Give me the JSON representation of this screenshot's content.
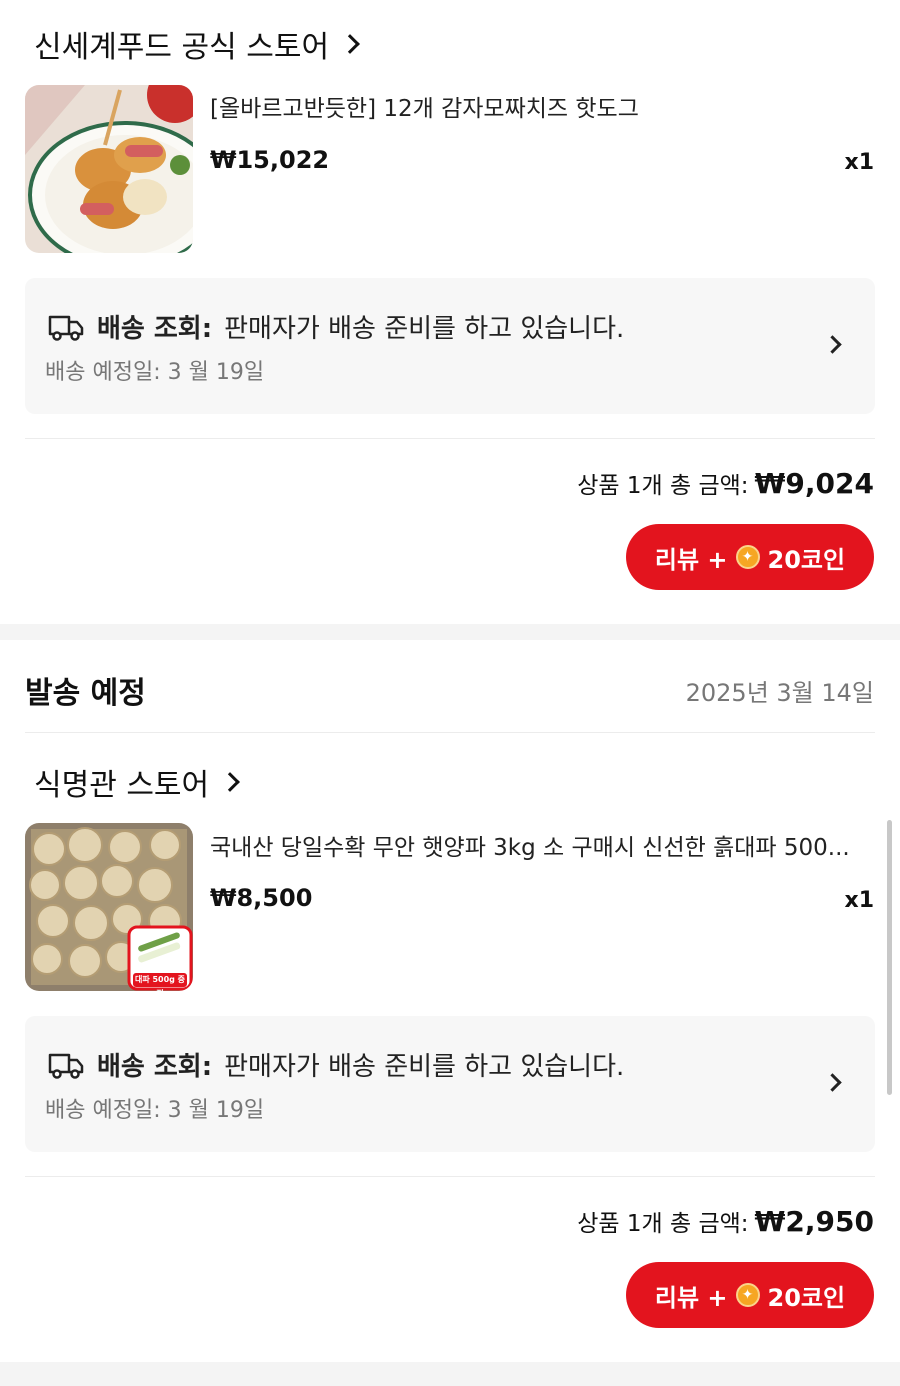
{
  "order1": {
    "store_name": "신세계푸드 공식 스토어",
    "product_title": "[올바르고반듯한] 12개 감자모짜치즈 핫도그",
    "price": "₩15,022",
    "qty": "x1",
    "shipping": {
      "label": "배송 조회:",
      "status": "판매자가 배송 준비를 하고 있습니다.",
      "eta": "배송 예정일: 3 월 19일"
    },
    "total_label": "상품 1개 총 금액:",
    "total_amount": "₩9,024",
    "review": {
      "prefix": "리뷰 +",
      "coins": "20코인"
    }
  },
  "section2": {
    "title": "발송 예정",
    "date": "2025년 3월 14일"
  },
  "order2": {
    "store_name": "식명관 스토어",
    "product_title": "국내산 당일수확 무안 햇양파 3kg 소 구매시 신선한 흙대파 500...",
    "price": "₩8,500",
    "qty": "x1",
    "badge": "대파 500g 증정",
    "shipping": {
      "label": "배송 조회:",
      "status": "판매자가 배송 준비를 하고 있습니다.",
      "eta": "배송 예정일: 3 월 19일"
    },
    "total_label": "상품 1개 총 금액:",
    "total_amount": "₩2,950",
    "review": {
      "prefix": "리뷰 +",
      "coins": "20코인"
    }
  },
  "colors": {
    "accent": "#e3141e",
    "coin": "#f6a623",
    "card_bg": "#f7f7f7",
    "muted": "#777777"
  },
  "icons": [
    "chevron-right-icon",
    "truck-icon",
    "coin-icon"
  ]
}
